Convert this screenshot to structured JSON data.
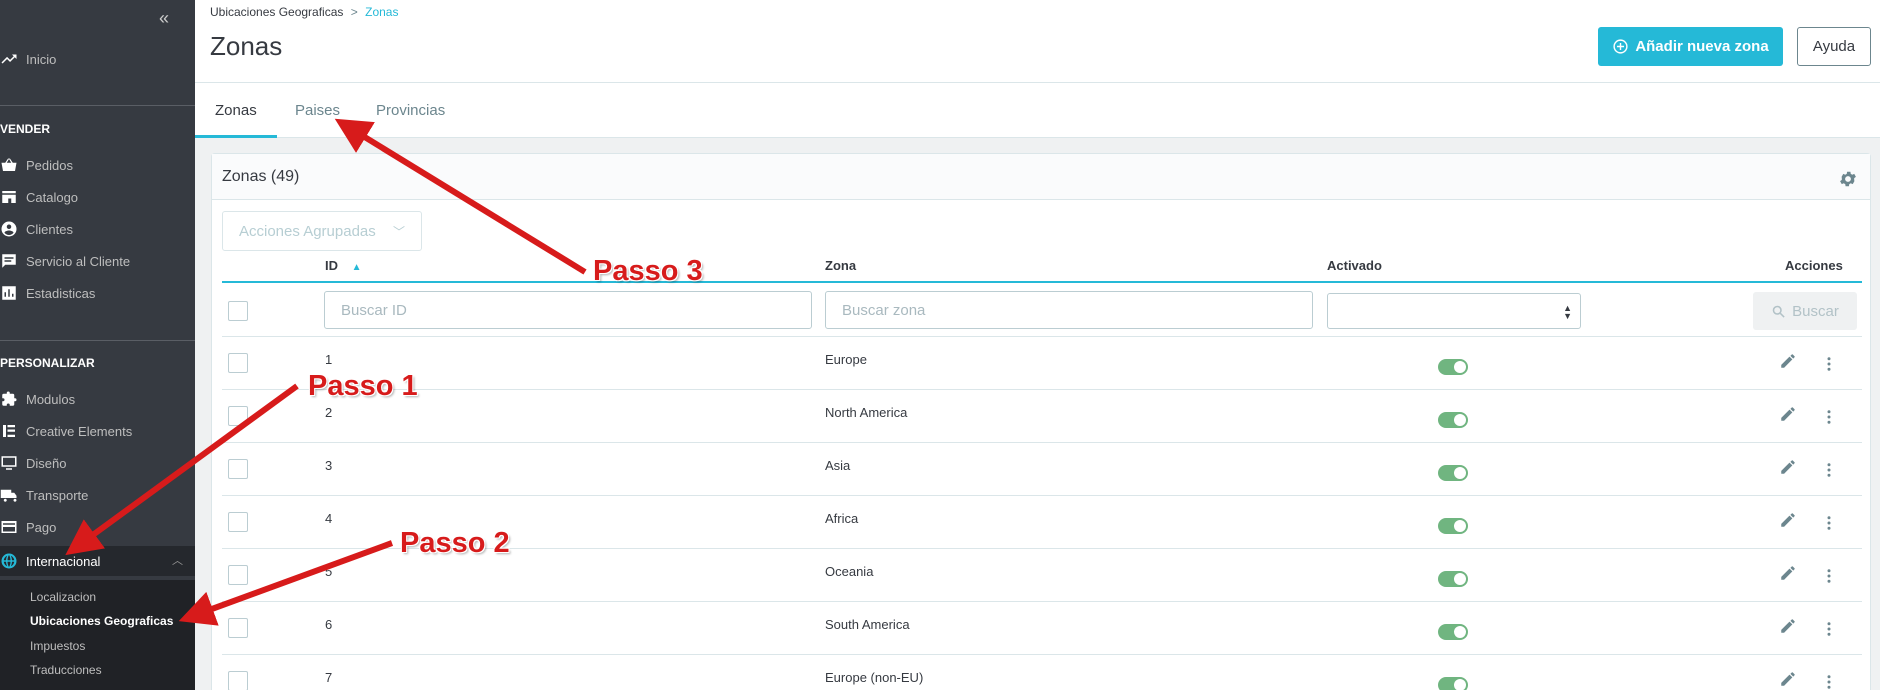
{
  "sidebar": {
    "collapse_icon": "«",
    "home": "Inicio",
    "section_sell": "VENDER",
    "sell_items": [
      "Pedidos",
      "Catalogo",
      "Clientes",
      "Servicio al Cliente",
      "Estadisticas"
    ],
    "section_customize": "PERSONALIZAR",
    "customize_items": [
      "Modulos",
      "Creative Elements",
      "Diseño",
      "Transporte",
      "Pago",
      "Internacional"
    ],
    "submenu": [
      "Localizacion",
      "Ubicaciones Geograficas",
      "Impuestos",
      "Traducciones"
    ]
  },
  "header": {
    "breadcrumb_parent": "Ubicaciones Geograficas",
    "breadcrumb_sep": ">",
    "breadcrumb_current": "Zonas",
    "title": "Zonas",
    "add_button": "Añadir nueva zona",
    "help_button": "Ayuda"
  },
  "tabs": [
    "Zonas",
    "Paises",
    "Provincias"
  ],
  "card": {
    "title": "Zonas (49)",
    "bulk_actions": "Acciones Agrupadas",
    "columns": {
      "id": "ID",
      "zone": "Zona",
      "active": "Activado",
      "actions": "Acciones"
    },
    "filters": {
      "id_placeholder": "Buscar ID",
      "zone_placeholder": "Buscar zona",
      "search_button": "Buscar"
    },
    "rows": [
      {
        "id": "1",
        "zone": "Europe",
        "active": true
      },
      {
        "id": "2",
        "zone": "North America",
        "active": true
      },
      {
        "id": "3",
        "zone": "Asia",
        "active": true
      },
      {
        "id": "4",
        "zone": "Africa",
        "active": true
      },
      {
        "id": "5",
        "zone": "Oceania",
        "active": true
      },
      {
        "id": "6",
        "zone": "South America",
        "active": true
      },
      {
        "id": "7",
        "zone": "Europe (non-EU)",
        "active": true
      }
    ]
  },
  "annotations": {
    "step1": "Passo 1",
    "step2": "Passo 2",
    "step3": "Passo 3"
  },
  "colors": {
    "accent": "#25b9d7",
    "sidebar": "#363a41",
    "toggle_on": "#70b580",
    "annotation": "#d71b1b"
  }
}
